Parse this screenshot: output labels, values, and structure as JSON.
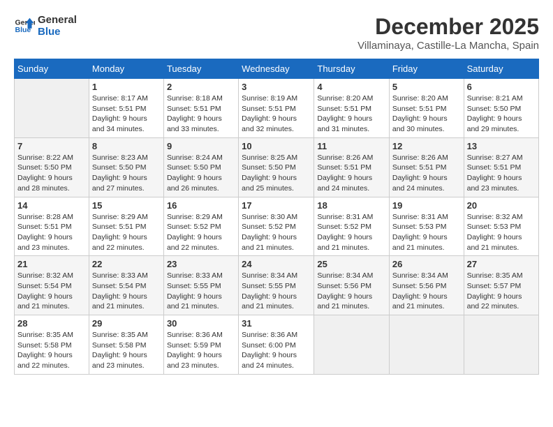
{
  "logo": {
    "line1": "General",
    "line2": "Blue"
  },
  "title": "December 2025",
  "subtitle": "Villaminaya, Castille-La Mancha, Spain",
  "weekdays": [
    "Sunday",
    "Monday",
    "Tuesday",
    "Wednesday",
    "Thursday",
    "Friday",
    "Saturday"
  ],
  "weeks": [
    [
      {
        "day": "",
        "info": ""
      },
      {
        "day": "1",
        "info": "Sunrise: 8:17 AM\nSunset: 5:51 PM\nDaylight: 9 hours\nand 34 minutes."
      },
      {
        "day": "2",
        "info": "Sunrise: 8:18 AM\nSunset: 5:51 PM\nDaylight: 9 hours\nand 33 minutes."
      },
      {
        "day": "3",
        "info": "Sunrise: 8:19 AM\nSunset: 5:51 PM\nDaylight: 9 hours\nand 32 minutes."
      },
      {
        "day": "4",
        "info": "Sunrise: 8:20 AM\nSunset: 5:51 PM\nDaylight: 9 hours\nand 31 minutes."
      },
      {
        "day": "5",
        "info": "Sunrise: 8:20 AM\nSunset: 5:51 PM\nDaylight: 9 hours\nand 30 minutes."
      },
      {
        "day": "6",
        "info": "Sunrise: 8:21 AM\nSunset: 5:50 PM\nDaylight: 9 hours\nand 29 minutes."
      }
    ],
    [
      {
        "day": "7",
        "info": "Sunrise: 8:22 AM\nSunset: 5:50 PM\nDaylight: 9 hours\nand 28 minutes."
      },
      {
        "day": "8",
        "info": "Sunrise: 8:23 AM\nSunset: 5:50 PM\nDaylight: 9 hours\nand 27 minutes."
      },
      {
        "day": "9",
        "info": "Sunrise: 8:24 AM\nSunset: 5:50 PM\nDaylight: 9 hours\nand 26 minutes."
      },
      {
        "day": "10",
        "info": "Sunrise: 8:25 AM\nSunset: 5:50 PM\nDaylight: 9 hours\nand 25 minutes."
      },
      {
        "day": "11",
        "info": "Sunrise: 8:26 AM\nSunset: 5:51 PM\nDaylight: 9 hours\nand 24 minutes."
      },
      {
        "day": "12",
        "info": "Sunrise: 8:26 AM\nSunset: 5:51 PM\nDaylight: 9 hours\nand 24 minutes."
      },
      {
        "day": "13",
        "info": "Sunrise: 8:27 AM\nSunset: 5:51 PM\nDaylight: 9 hours\nand 23 minutes."
      }
    ],
    [
      {
        "day": "14",
        "info": "Sunrise: 8:28 AM\nSunset: 5:51 PM\nDaylight: 9 hours\nand 23 minutes."
      },
      {
        "day": "15",
        "info": "Sunrise: 8:29 AM\nSunset: 5:51 PM\nDaylight: 9 hours\nand 22 minutes."
      },
      {
        "day": "16",
        "info": "Sunrise: 8:29 AM\nSunset: 5:52 PM\nDaylight: 9 hours\nand 22 minutes."
      },
      {
        "day": "17",
        "info": "Sunrise: 8:30 AM\nSunset: 5:52 PM\nDaylight: 9 hours\nand 21 minutes."
      },
      {
        "day": "18",
        "info": "Sunrise: 8:31 AM\nSunset: 5:52 PM\nDaylight: 9 hours\nand 21 minutes."
      },
      {
        "day": "19",
        "info": "Sunrise: 8:31 AM\nSunset: 5:53 PM\nDaylight: 9 hours\nand 21 minutes."
      },
      {
        "day": "20",
        "info": "Sunrise: 8:32 AM\nSunset: 5:53 PM\nDaylight: 9 hours\nand 21 minutes."
      }
    ],
    [
      {
        "day": "21",
        "info": "Sunrise: 8:32 AM\nSunset: 5:54 PM\nDaylight: 9 hours\nand 21 minutes."
      },
      {
        "day": "22",
        "info": "Sunrise: 8:33 AM\nSunset: 5:54 PM\nDaylight: 9 hours\nand 21 minutes."
      },
      {
        "day": "23",
        "info": "Sunrise: 8:33 AM\nSunset: 5:55 PM\nDaylight: 9 hours\nand 21 minutes."
      },
      {
        "day": "24",
        "info": "Sunrise: 8:34 AM\nSunset: 5:55 PM\nDaylight: 9 hours\nand 21 minutes."
      },
      {
        "day": "25",
        "info": "Sunrise: 8:34 AM\nSunset: 5:56 PM\nDaylight: 9 hours\nand 21 minutes."
      },
      {
        "day": "26",
        "info": "Sunrise: 8:34 AM\nSunset: 5:56 PM\nDaylight: 9 hours\nand 21 minutes."
      },
      {
        "day": "27",
        "info": "Sunrise: 8:35 AM\nSunset: 5:57 PM\nDaylight: 9 hours\nand 22 minutes."
      }
    ],
    [
      {
        "day": "28",
        "info": "Sunrise: 8:35 AM\nSunset: 5:58 PM\nDaylight: 9 hours\nand 22 minutes."
      },
      {
        "day": "29",
        "info": "Sunrise: 8:35 AM\nSunset: 5:58 PM\nDaylight: 9 hours\nand 23 minutes."
      },
      {
        "day": "30",
        "info": "Sunrise: 8:36 AM\nSunset: 5:59 PM\nDaylight: 9 hours\nand 23 minutes."
      },
      {
        "day": "31",
        "info": "Sunrise: 8:36 AM\nSunset: 6:00 PM\nDaylight: 9 hours\nand 24 minutes."
      },
      {
        "day": "",
        "info": ""
      },
      {
        "day": "",
        "info": ""
      },
      {
        "day": "",
        "info": ""
      }
    ]
  ]
}
